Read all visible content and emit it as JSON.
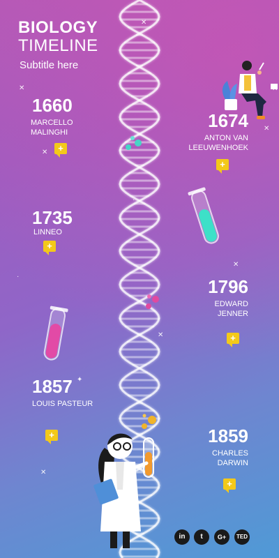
{
  "header": {
    "title_line1": "BIOLOGY",
    "title_line2": "TIMELINE",
    "subtitle": "Subtitle here"
  },
  "events": [
    {
      "year": "1660",
      "name_line1": "MARCELLO",
      "name_line2": "MALINGHI",
      "side": "left"
    },
    {
      "year": "1674",
      "name_line1": "ANTON VAN",
      "name_line2": "LEEUWENHOEK",
      "side": "right"
    },
    {
      "year": "1735",
      "name_line1": "LINNEO",
      "name_line2": "",
      "side": "left"
    },
    {
      "year": "1796",
      "name_line1": "EDWARD",
      "name_line2": "JENNER",
      "side": "right"
    },
    {
      "year": "1857",
      "name_line1": "LOUIS PASTEUR",
      "name_line2": "",
      "side": "left"
    },
    {
      "year": "1859",
      "name_line1": "CHARLES",
      "name_line2": "DARWIN",
      "side": "right"
    }
  ],
  "plus_symbol": "+",
  "social": {
    "linkedin": "in",
    "twitter": "t",
    "googleplus": "G+",
    "ted": "TED"
  },
  "colors": {
    "accent_yellow": "#f3c91a",
    "top": "#b25ab8",
    "bottom": "#4f9ad6"
  }
}
